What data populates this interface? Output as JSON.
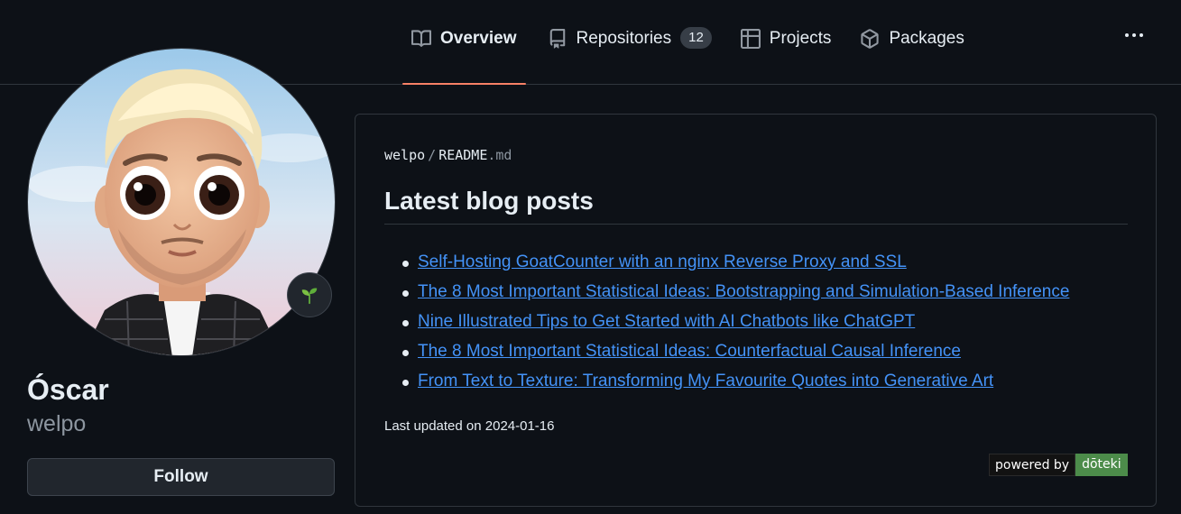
{
  "nav": {
    "tabs": [
      {
        "label": "Overview",
        "icon": "book-icon",
        "active": true
      },
      {
        "label": "Repositories",
        "icon": "repo-icon",
        "count": "12"
      },
      {
        "label": "Projects",
        "icon": "table-icon"
      },
      {
        "label": "Packages",
        "icon": "package-icon"
      }
    ],
    "more_icon": "kebab-horizontal-icon"
  },
  "profile": {
    "display_name": "Óscar",
    "username": "welpo",
    "follow_label": "Follow",
    "status_icon": "seedling-icon"
  },
  "readme": {
    "owner": "welpo",
    "separator": "/",
    "file_name": "README",
    "file_ext": ".md",
    "title": "Latest blog posts",
    "posts": [
      "Self-Hosting GoatCounter with an nginx Reverse Proxy and SSL",
      "The 8 Most Important Statistical Ideas: Bootstrapping and Simulation-Based Inference",
      "Nine Illustrated Tips to Get Started with AI Chatbots like ChatGPT",
      "The 8 Most Important Statistical Ideas: Counterfactual Causal Inference",
      "From Text to Texture: Transforming My Favourite Quotes into Generative Art"
    ],
    "updated": "Last updated on 2024-01-16",
    "badge_left": "powered by",
    "badge_right": "dōteki"
  },
  "colors": {
    "background": "#0d1117",
    "link": "#4493f8",
    "active_tab_underline": "#f78166",
    "badge_green": "#4c8c4a"
  }
}
